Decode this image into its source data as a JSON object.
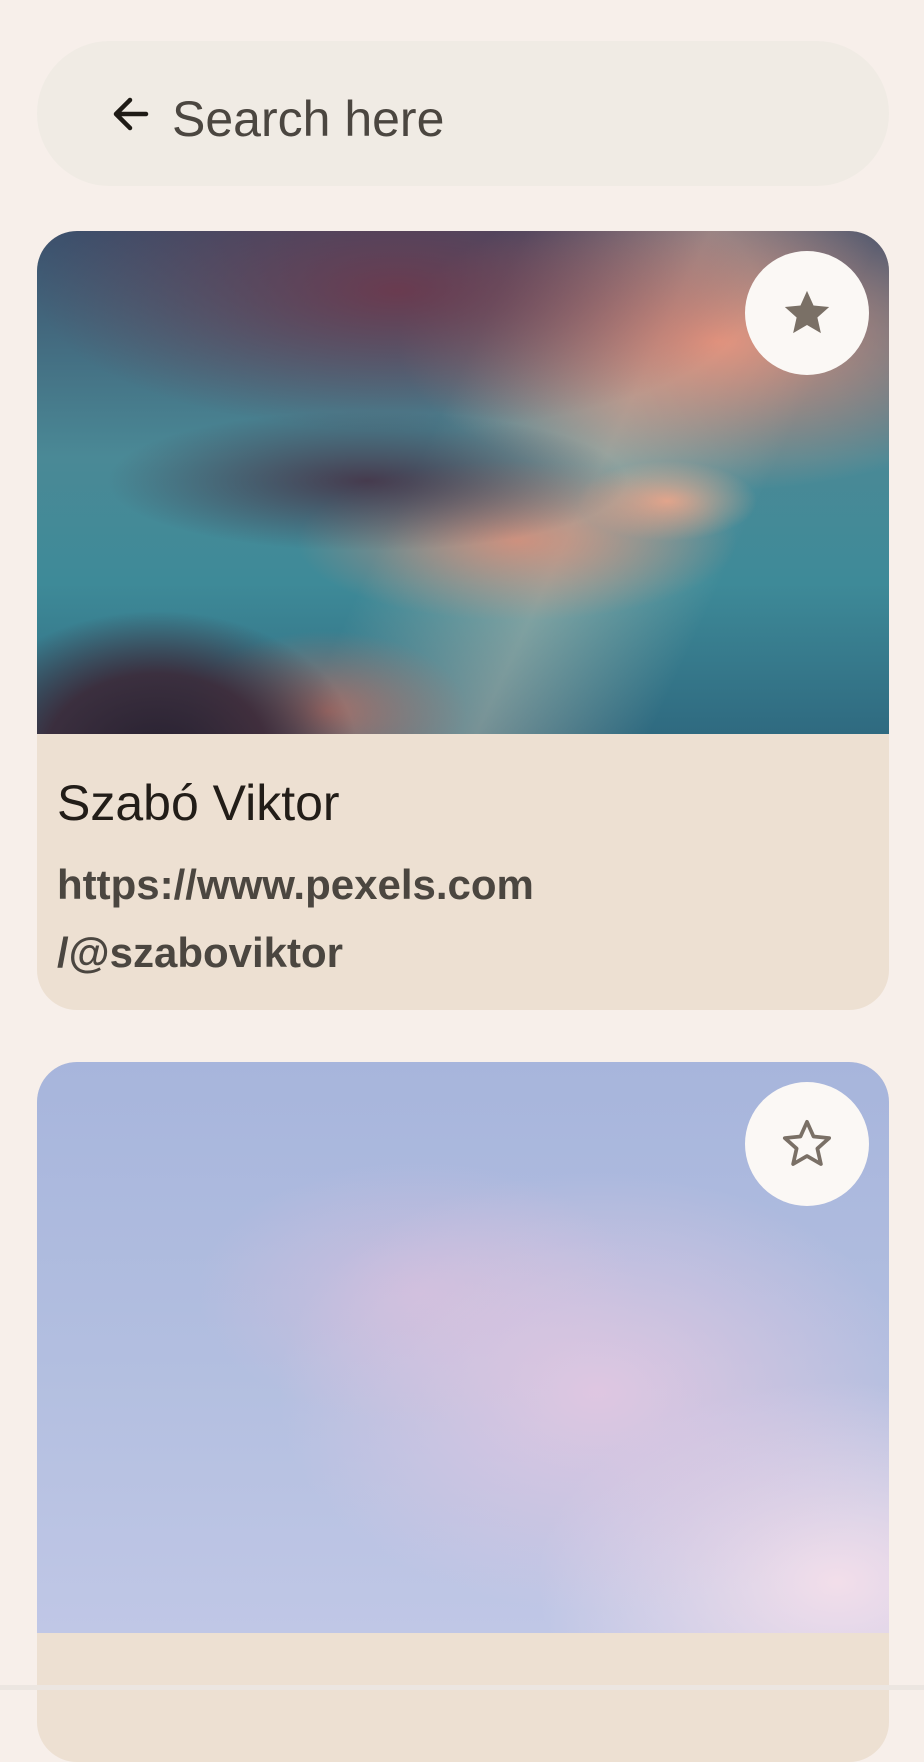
{
  "search": {
    "placeholder": "Search here",
    "back_icon": "arrow-left-icon"
  },
  "cards": [
    {
      "name": "Szabó Viktor",
      "url_line1": "https://www.pexels.com",
      "url_line2": "/@szaboviktor",
      "favorite": true,
      "favorite_icon": "star-filled-icon",
      "image": "sunset-clouds-photo"
    },
    {
      "favorite": false,
      "favorite_icon": "star-outline-icon",
      "image": "pastel-sky-photo"
    }
  ],
  "colors": {
    "background": "#f7efea",
    "search_bar": "#f0ebe4",
    "card_footer": "#ede0d2",
    "icon": "#7a7066",
    "title_text": "#221d18",
    "secondary_text": "#4b4640"
  }
}
